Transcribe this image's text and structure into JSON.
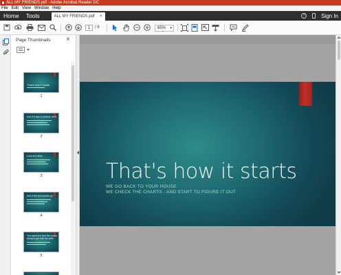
{
  "window": {
    "title": "ALL MY FRIENDS.pdf - Adobe Acrobat Reader DC"
  },
  "menu": [
    "File",
    "Edit",
    "View",
    "Window",
    "Help"
  ],
  "tabs": {
    "home": "Home",
    "tools": "Tools",
    "doc": "ALL MY FRIENDS.pdf",
    "doc_close": "×",
    "sign_in": "Sign In"
  },
  "toolbar": {
    "page_current": "1",
    "page_total": "/ 8",
    "zoom": "65%",
    "icons": [
      "save-icon",
      "upload-icon",
      "print-icon",
      "email-icon",
      "search-icon",
      "page-up-icon",
      "page-down-icon",
      "select-cursor-icon",
      "hand-icon",
      "zoom-out-icon",
      "zoom-in-icon",
      "fit-page-icon",
      "page-view-icon",
      "full-screen-icon",
      "read-mode-icon",
      "comment-icon",
      "pen-icon"
    ]
  },
  "panel": {
    "title": "Page Thumbnails",
    "close": "×",
    "thumbnails": [
      {
        "num": "1",
        "text": "That's how it starts"
      },
      {
        "num": "2",
        "text": "And if it was a contest, we'd be tied for"
      },
      {
        "num": "3",
        "text": "Look at it drink"
      },
      {
        "num": "4",
        "text": "And if the sun comes up"
      },
      {
        "num": "5",
        "text": "You spent the first five years trying to get with the plan"
      },
      {
        "num": "6",
        "text": ""
      }
    ]
  },
  "slide": {
    "title": "That's how it starts",
    "sub1": "WE GO BACK TO YOUR HOUSE",
    "sub2": "WE CHECK THE CHARTS - AND START TO FIGURE IT OUT",
    "accent": "#b32a23",
    "bg": "#1f6c72"
  }
}
